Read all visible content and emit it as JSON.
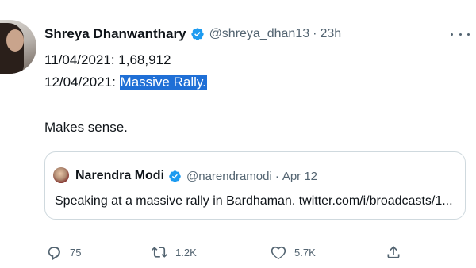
{
  "tweet": {
    "author_name": "Shreya Dhanwanthary",
    "handle": "@shreya_dhan13",
    "separator": "·",
    "time": "23h",
    "text_line1": "11/04/2021: 1,68,912",
    "text_line2_prefix": "12/04/2021: ",
    "text_line2_highlight": "Massive Rally.",
    "text_line3": "Makes sense.",
    "icons": {
      "verified": "verified-badge-icon",
      "more": "more-options-icon"
    }
  },
  "quote": {
    "author_name": "Narendra Modi",
    "handle": "@narendramodi",
    "separator": "·",
    "time": "Apr 12",
    "text": "Speaking at a massive rally in Bardhaman. twitter.com/i/broadcasts/1..."
  },
  "actions": {
    "reply_count": "75",
    "retweet_count": "1.2K",
    "like_count": "5.7K",
    "icons": {
      "reply": "reply-icon",
      "retweet": "retweet-icon",
      "like": "like-icon",
      "share": "share-icon"
    }
  },
  "colors": {
    "verified_blue": "#1d9bf0",
    "secondary_text": "#536471",
    "highlight": "#1f6fd6",
    "border": "#cfd9de"
  }
}
